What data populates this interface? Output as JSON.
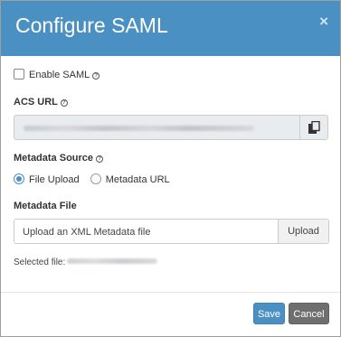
{
  "dialog": {
    "title": "Configure SAML",
    "close_glyph": "×"
  },
  "enable_saml": {
    "label": "Enable SAML",
    "checked": false,
    "help_icon": "question-circle-icon"
  },
  "acs_url": {
    "label": "ACS URL",
    "help_icon": "question-circle-icon",
    "copy_icon": "copy-icon"
  },
  "metadata_source": {
    "label": "Metadata Source",
    "help_icon": "question-circle-icon",
    "options": [
      {
        "label": "File Upload",
        "selected": true
      },
      {
        "label": "Metadata URL",
        "selected": false
      }
    ]
  },
  "metadata_file": {
    "label": "Metadata File",
    "placeholder": "Upload an XML Metadata file",
    "upload_label": "Upload",
    "selected_file_label": "Selected file:"
  },
  "footer": {
    "save_label": "Save",
    "cancel_label": "Cancel"
  },
  "colors": {
    "header": "#4a90c2",
    "save_button": "#4a90c2",
    "cancel_button": "#6f6f6f"
  }
}
